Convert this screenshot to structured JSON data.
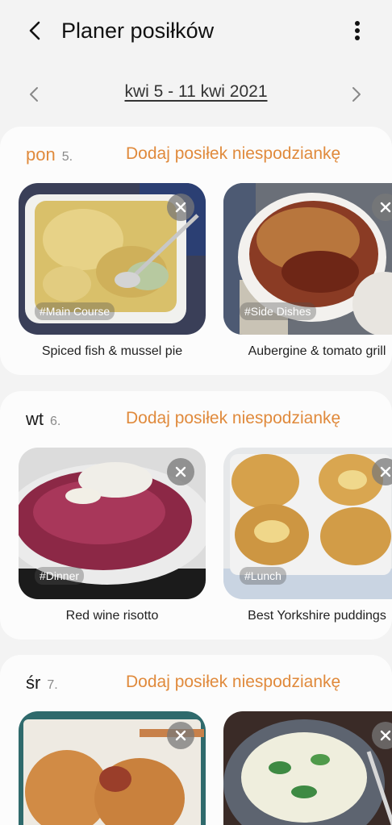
{
  "header": {
    "title": "Planer posiłków"
  },
  "week": {
    "range_label": "kwi 5 - 11 kwi 2021"
  },
  "days": [
    {
      "day_name": "pon",
      "day_number": "5.",
      "surprise_label": "Dodaj posiłek niespodziankę",
      "recipes": [
        {
          "name": "Spiced fish & mussel pie",
          "tag": "#Main Course"
        },
        {
          "name": "Aubergine & tomato grill",
          "tag": "#Side Dishes"
        }
      ]
    },
    {
      "day_name": "wt",
      "day_number": "6.",
      "surprise_label": "Dodaj posiłek niespodziankę",
      "recipes": [
        {
          "name": "Red wine risotto",
          "tag": "#Dinner"
        },
        {
          "name": "Best Yorkshire puddings",
          "tag": "#Lunch"
        }
      ]
    },
    {
      "day_name": "śr",
      "day_number": "7.",
      "surprise_label": "Dodaj posiłek niespodziankę",
      "recipes": [
        {
          "name": "",
          "tag": ""
        },
        {
          "name": "",
          "tag": ""
        }
      ]
    }
  ],
  "icons": {
    "back": "arrow-left-icon",
    "more": "more-vert-icon",
    "prev": "chevron-left-icon",
    "next": "chevron-right-icon",
    "remove": "close-icon"
  },
  "colors": {
    "accent": "#e08a3c",
    "background": "#f3f3f3",
    "card": "#fcfcfc"
  }
}
